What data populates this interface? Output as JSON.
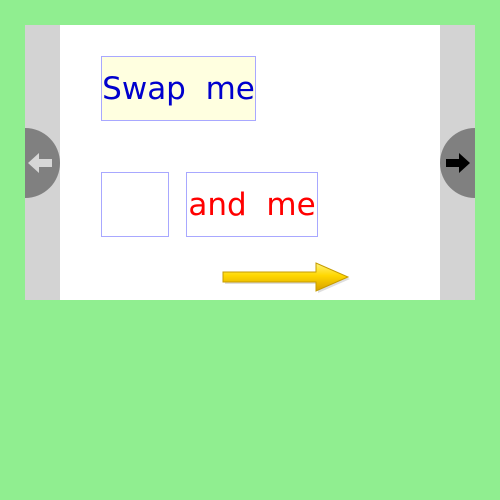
{
  "words": {
    "first": "Swap  me",
    "empty": "",
    "second": "and  me"
  },
  "navigation": {
    "prev_icon": "arrow-left-icon",
    "next_icon": "arrow-right-icon"
  },
  "decoration": {
    "arrow_icon": "yellow-arrow-right-icon"
  },
  "colors": {
    "background": "#90ee90",
    "stage_side": "#d3d3d3",
    "work_area": "#ffffff",
    "box_border": "#a8a8ff",
    "highlight_fill": "#ffffe0",
    "first_word": "#0000cd",
    "second_word": "#ff0000",
    "nav_button": "#808080",
    "arrow": "#ffd700"
  }
}
